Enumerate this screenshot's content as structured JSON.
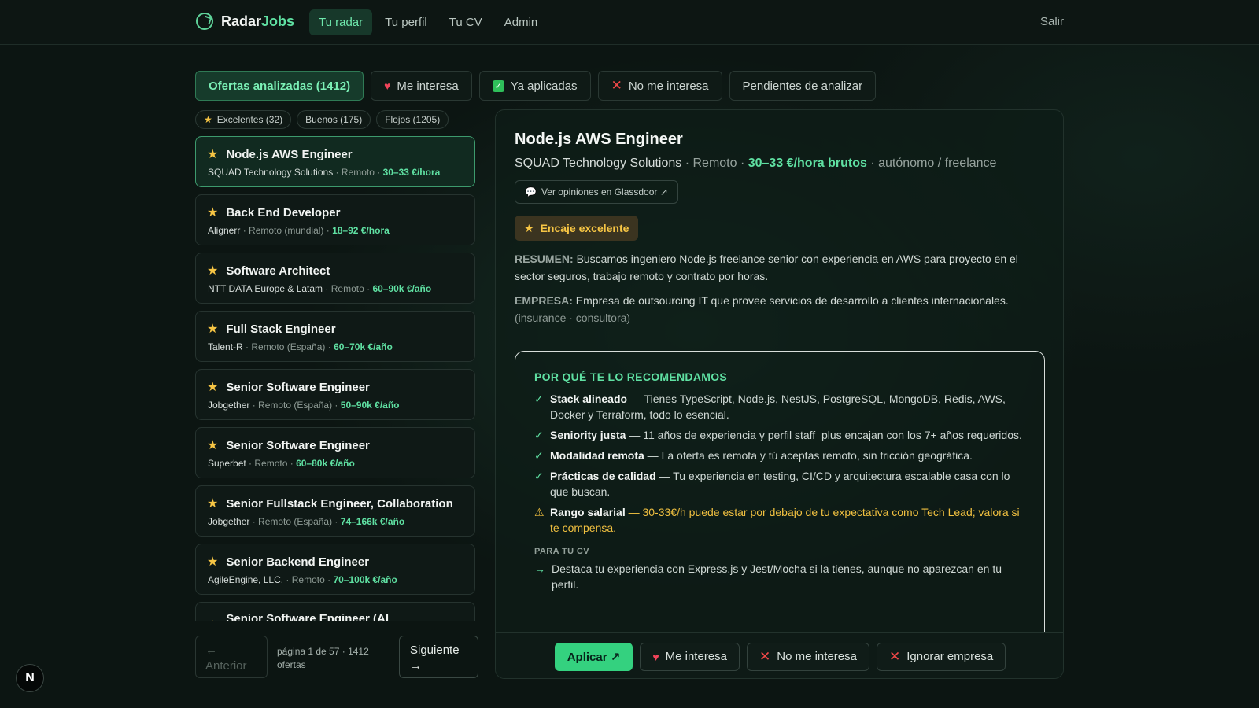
{
  "brand": {
    "name_prefix": "Radar",
    "name_suffix": "Jobs"
  },
  "nav": {
    "items": [
      {
        "label": "Tu radar",
        "active": true
      },
      {
        "label": "Tu perfil"
      },
      {
        "label": "Tu CV"
      },
      {
        "label": "Admin"
      }
    ],
    "logout": "Salir"
  },
  "status_tabs": {
    "analyzed": "Ofertas analizadas (1412)",
    "interested": "Me interesa",
    "applied": "Ya aplicadas",
    "not_interested": "No me interesa",
    "pending": "Pendientes de analizar"
  },
  "quality_filters": {
    "excellent": "Excelentes (32)",
    "good": "Buenos (175)",
    "weak": "Flojos (1205)"
  },
  "jobs": [
    {
      "title": "Node.js AWS Engineer",
      "company": "SQUAD Technology Solutions",
      "location": "Remoto",
      "salary": "30–33 €/hora"
    },
    {
      "title": "Back End Developer",
      "company": "Alignerr",
      "location": "Remoto (mundial)",
      "salary": "18–92 €/hora"
    },
    {
      "title": "Software Architect",
      "company": "NTT DATA Europe & Latam",
      "location": "Remoto",
      "salary": "60–90k €/año"
    },
    {
      "title": "Full Stack Engineer",
      "company": "Talent-R",
      "location": "Remoto (España)",
      "salary": "60–70k €/año"
    },
    {
      "title": "Senior Software Engineer",
      "company": "Jobgether",
      "location": "Remoto (España)",
      "salary": "50–90k €/año"
    },
    {
      "title": "Senior Software Engineer",
      "company": "Superbet",
      "location": "Remoto",
      "salary": "60–80k €/año"
    },
    {
      "title": "Senior Fullstack Engineer, Collaboration",
      "company": "Jobgether",
      "location": "Remoto (España)",
      "salary": "74–166k €/año"
    },
    {
      "title": "Senior Backend Engineer",
      "company": "AgileEngine, LLC.",
      "location": "Remoto",
      "salary": "70–100k €/año"
    },
    {
      "title": "Senior Software Engineer (AI Infrastructure)",
      "company": "",
      "location": "",
      "salary": ""
    }
  ],
  "pagination": {
    "prev_arrow": "←",
    "prev": "Anterior",
    "info": "página 1 de 57 · 1412 ofertas",
    "next": "Siguiente",
    "next_arrow": "→"
  },
  "detail": {
    "title": "Node.js AWS Engineer",
    "company": "SQUAD Technology Solutions",
    "location": "Remoto",
    "salary": "30–33 €/hora brutos",
    "contract": "autónomo / freelance",
    "glassdoor": "Ver opiniones en Glassdoor ↗",
    "fit_badge": "Encaje excelente",
    "summary_label": "RESUMEN:",
    "summary": "Buscamos ingeniero Node.js freelance senior con experiencia en AWS para proyecto en el sector seguros, trabajo remoto y contrato por horas.",
    "company_label": "EMPRESA:",
    "company_desc": "Empresa de outsourcing IT que provee servicios de desarrollo a clientes internacionales.",
    "company_tags": "(insurance · consultora)",
    "why_heading": "POR QUÉ TE LO RECOMENDAMOS",
    "reasons": [
      {
        "title": "Stack alineado",
        "text": " — Tienes TypeScript, Node.js, NestJS, PostgreSQL, MongoDB, Redis, AWS, Docker y Terraform, todo lo esencial."
      },
      {
        "title": "Seniority justa",
        "text": " — 11 años de experiencia y perfil staff_plus encajan con los 7+ años requeridos."
      },
      {
        "title": "Modalidad remota",
        "text": " — La oferta es remota y tú aceptas remoto, sin fricción geográfica."
      },
      {
        "title": "Prácticas de calidad",
        "text": " — Tu experiencia en testing, CI/CD y arquitectura escalable casa con lo que buscan."
      }
    ],
    "warning": {
      "title": "Rango salarial",
      "text": " — 30-33€/h puede estar por debajo de tu expectativa como Tech Lead; valora si te compensa."
    },
    "cv_heading": "PARA TU CV",
    "cv_tip": "Destaca tu experiencia con Express.js y Jest/Mocha si la tienes, aunque no aparezcan en tu perfil."
  },
  "actions": {
    "apply": "Aplicar ↗",
    "interested": "Me interesa",
    "not_interested": "No me interesa",
    "ignore_company": "Ignorar empresa"
  },
  "floating_badge": "N",
  "colors": {
    "accent": "#5fe0a2",
    "primary_button": "#34d17f",
    "warning": "#f0c040",
    "star": "#f6c544",
    "danger": "#f04848"
  },
  "icons": [
    "radar-logo-icon",
    "heart-icon",
    "check-icon",
    "x-icon",
    "star-icon",
    "chat-icon",
    "arrow-right-icon",
    "arrow-left-icon",
    "warning-icon"
  ]
}
